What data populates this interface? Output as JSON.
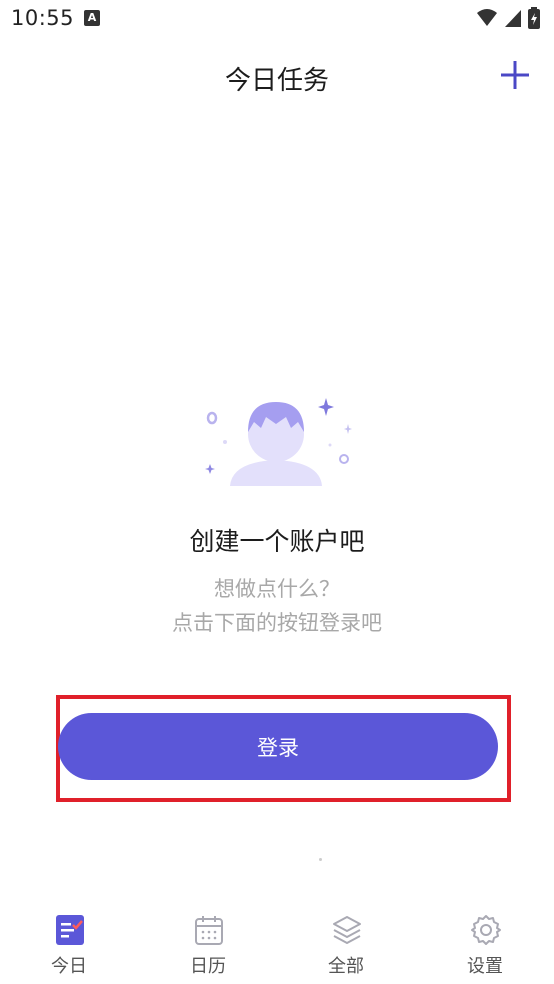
{
  "status_bar": {
    "time": "10:55",
    "notification_icon": "a-notification-icon"
  },
  "app_bar": {
    "title": "今日任务",
    "add_icon": "plus-icon"
  },
  "empty_state": {
    "title": "创建一个账户吧",
    "subtitle_line1": "想做点什么？",
    "subtitle_line2": "点击下面的按钮登录吧"
  },
  "login_button": {
    "label": "登录"
  },
  "bottom_nav": {
    "items": [
      {
        "label": "今日",
        "icon": "today-list-icon",
        "active": true
      },
      {
        "label": "日历",
        "icon": "calendar-icon",
        "active": false
      },
      {
        "label": "全部",
        "icon": "layers-icon",
        "active": false
      },
      {
        "label": "设置",
        "icon": "gear-icon",
        "active": false
      }
    ]
  },
  "colors": {
    "accent": "#5b57d8",
    "highlight": "#e0202a",
    "muted_text": "#a8a8a8"
  }
}
